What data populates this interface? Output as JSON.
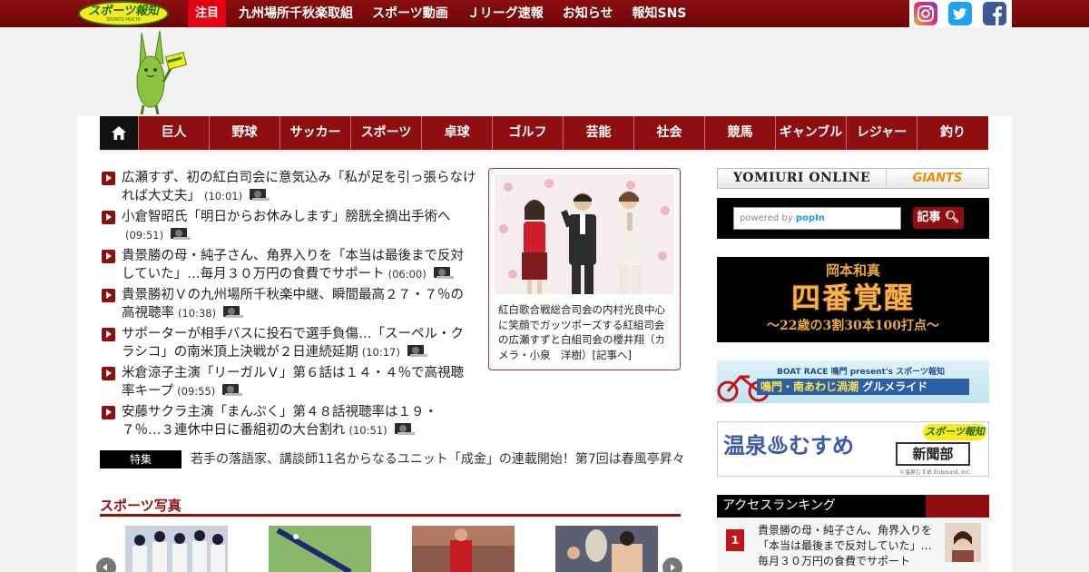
{
  "header": {
    "logo_text": "スポーツ報知",
    "logo_sub": "SPORTS HOCHI",
    "nav": [
      "注目",
      "九州場所千秋楽取組",
      "スポーツ動画",
      "Ｊリーグ速報",
      "お知らせ",
      "報知SNS"
    ],
    "social": [
      "instagram-icon",
      "twitter-icon",
      "facebook-icon"
    ]
  },
  "categories": [
    "巨人",
    "野球",
    "サッカー",
    "スポーツ",
    "卓球",
    "ゴルフ",
    "芸能",
    "社会",
    "競馬",
    "ギャンブル",
    "レジャー",
    "釣り"
  ],
  "news": [
    {
      "title": "広瀬すず、初の紅白司会に意気込み「私が足を引っ張らなければ大丈夫」",
      "time": "(10:01)"
    },
    {
      "title": "小倉智昭氏「明日からお休みします」膀胱全摘出手術へ",
      "time": "(09:51)"
    },
    {
      "title": "貴景勝の母・純子さん、角界入りを「本当は最後まで反対していた」…毎月３０万円の食費でサポート",
      "time": "(06:00)"
    },
    {
      "title": "貴景勝初Ｖの九州場所千秋楽中継、瞬間最高２７・７％の高視聴率",
      "time": "(10:38)"
    },
    {
      "title": "サポーターが相手バスに投石で選手負傷…「スーペル・クラシコ」の南米頂上決戦が２日連続延期",
      "time": "(10:17)"
    },
    {
      "title": "米倉涼子主演「リーガルＶ」第６話は１４・４％で高視聴率キープ",
      "time": "(09:55)"
    },
    {
      "title": "安藤サクラ主演「まんぷく」第４８話視聴率は１９・７％…３連休中日に番組初の大台割れ",
      "time": "(10:51)"
    }
  ],
  "feature": {
    "caption": "紅白歌合戦総合司会の内村光良中心に笑顔でガッツポーズする紅組司会の広瀬すずと白組司会の櫻井翔（カメラ・小泉　洋樹）[記事へ]"
  },
  "tokushu": {
    "label": "特集",
    "text": "若手の落語家、講談師11名からなるユニット「成金」の連載開始！第7回は春風亭昇々"
  },
  "sports_photo": {
    "title": "スポーツ写真"
  },
  "sidebar": {
    "yomiuri": "YOMIURI ONLINE",
    "giants": "GIANTS",
    "search_placeholder_prefix": "powered by",
    "search_placeholder_brand": "popIn",
    "search_button": "記事",
    "ad1": {
      "top": "岡本和真",
      "main": "四番覚醒",
      "bottom": "〜22歳の3割30本100打点〜"
    },
    "ad2": {
      "top": "BOAT RACE 鳴門 present's スポーツ報知",
      "main_a": "鳴門・南あわじ渦潮",
      "main_b": " グルメライド"
    },
    "ad3": {
      "title": "温泉♨むすめ",
      "badge": "スポーツ報知",
      "box": "新聞部",
      "credit": "©温泉むすめ Enbound, Inc."
    },
    "ranking_title": "アクセスランキング",
    "ranking": [
      {
        "rank": "1",
        "text": "貴景勝の母・純子さん、角界入りを「本当は最後まで反対していた」…毎月３０万円の食費でサポート"
      }
    ]
  },
  "colors": {
    "brand_red": "#8f0f10",
    "hot_red": "#e60012",
    "logo_yellow": "#f4ea1e"
  }
}
